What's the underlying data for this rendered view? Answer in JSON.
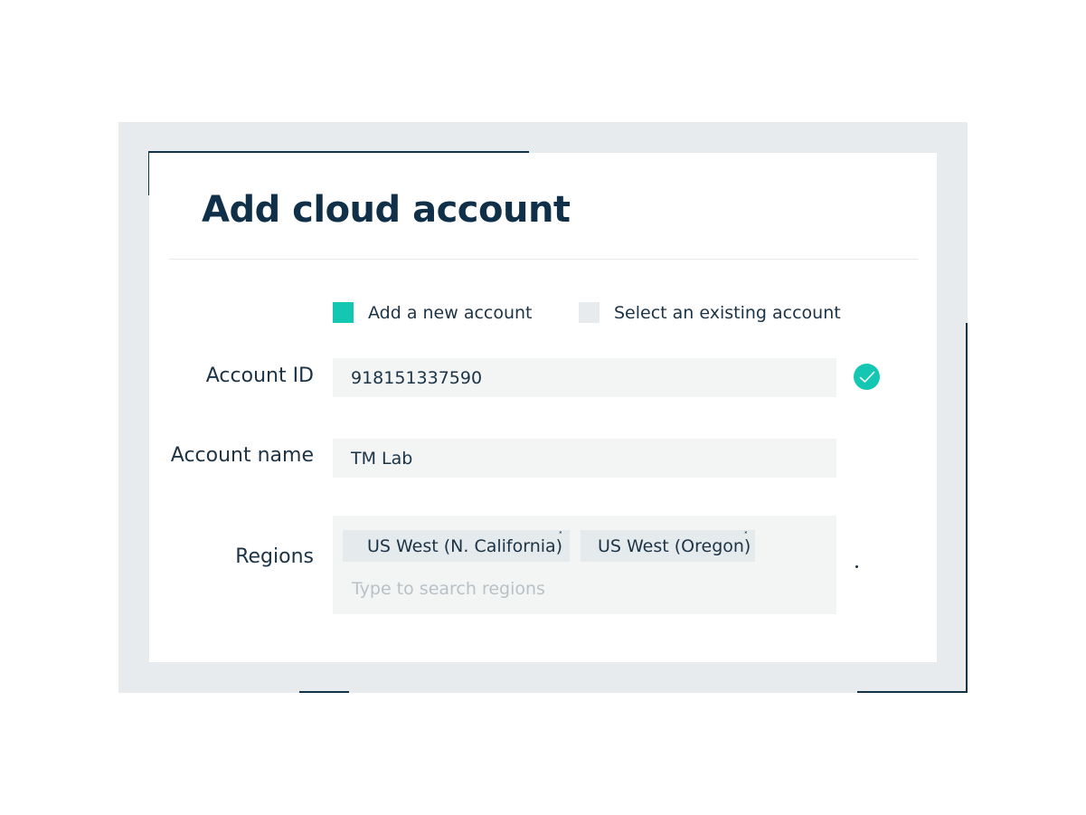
{
  "dialog": {
    "title": "Add cloud account"
  },
  "account_mode": {
    "options": [
      {
        "label": "Add a new account",
        "selected": true
      },
      {
        "label": "Select an existing account",
        "selected": false
      }
    ]
  },
  "fields": {
    "account_id": {
      "label": "Account ID",
      "value": "918151337590",
      "validated": true
    },
    "account_name": {
      "label": "Account name",
      "value": "TM Lab"
    },
    "regions": {
      "label": "Regions",
      "tags": [
        {
          "label": "US West (N. California)",
          "remove": "˟"
        },
        {
          "label": "US West (Oregon)",
          "remove": "˟"
        }
      ],
      "placeholder": "Type to search regions"
    }
  },
  "colors": {
    "accent": "#14c7b3",
    "text_dark": "#0f3048",
    "frame": "#e7ebee",
    "input_bg": "#f3f5f5",
    "tag_bg": "#e5eaed"
  },
  "icons": {
    "valid": "check-circle-icon",
    "remove": "close-icon"
  }
}
